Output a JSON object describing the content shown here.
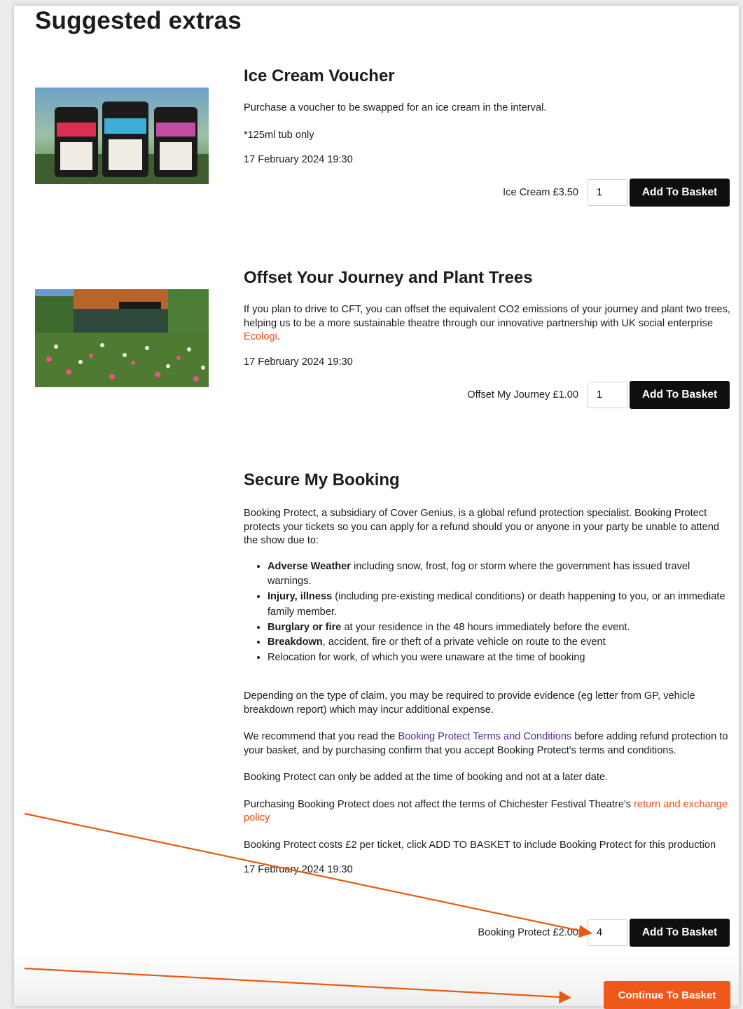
{
  "page": {
    "title": "Suggested extras"
  },
  "extras": [
    {
      "title": "Ice Cream Voucher",
      "image": "ice-cream-tubs-image",
      "paragraphs": [
        "Purchase a voucher to be swapped for an ice cream in the interval.",
        "*125ml tub only"
      ],
      "date": "17 February 2024 19:30",
      "price_label": "Ice Cream £3.50",
      "quantity": "1",
      "button_label": "Add To Basket"
    },
    {
      "title": "Offset Your Journey and Plant Trees",
      "image": "wildflower-meadow-image",
      "desc_before": "If you plan to drive to CFT, you can offset the equivalent CO2 emissions of your journey and plant two trees, helping us to be a more sustainable theatre through our innovative partnership with UK social enterprise ",
      "desc_link": "Ecologi",
      "desc_after": ".",
      "date": "17 February 2024 19:30",
      "price_label": "Offset My Journey £1.00",
      "quantity": "1",
      "button_label": "Add To Basket"
    },
    {
      "title": "Secure My Booking",
      "intro": "Booking Protect, a subsidiary of Cover Genius, is a global refund protection specialist. Booking Protect protects your tickets so you can apply for a refund should you or anyone in your party be unable to attend the show due to:",
      "bullets": [
        {
          "bold": "Adverse Weather",
          "text": " including snow, frost, fog or storm where the government has issued travel warnings."
        },
        {
          "bold": "Injury, illness",
          "text": " (including pre-existing medical conditions) or death happening to you, or an immediate family member."
        },
        {
          "bold": "Burglary or fire",
          "text": " at your residence in the 48 hours immediately before the event."
        },
        {
          "bold": "Breakdown",
          "text": ", accident, fire or theft of a private vehicle on route to the event"
        },
        {
          "bold": "",
          "text": "Relocation for work, of which you were unaware at the time of booking"
        }
      ],
      "evidence": "Depending on the type of claim, you may be required to provide evidence (eg letter from GP, vehicle breakdown report) which may incur additional expense.",
      "terms_before": "We recommend that you read the ",
      "terms_link": "Booking Protect Terms and Conditions",
      "terms_after": " before adding refund protection to your basket, and by purchasing confirm that you accept Booking Protect's terms and conditions.",
      "only_at_booking": "Booking Protect can only be added at the time of booking and not at a later date.",
      "policy_before": "Purchasing Booking Protect does not affect the terms of Chichester Festival Theatre's ",
      "policy_link": "return and exchange policy",
      "cost_note": "Booking Protect costs £2 per ticket, click ADD TO BASKET to include Booking Protect for this production",
      "date": "17 February 2024 19:30",
      "price_label": "Booking Protect £2.00",
      "quantity": "4",
      "button_label": "Add To Basket"
    }
  ],
  "continue_button": "Continue To Basket",
  "colors": {
    "accent_orange": "#ee5818",
    "link_orange": "#e64f12",
    "link_purple": "#5a2a8e",
    "button_black": "#0f0f0f"
  }
}
